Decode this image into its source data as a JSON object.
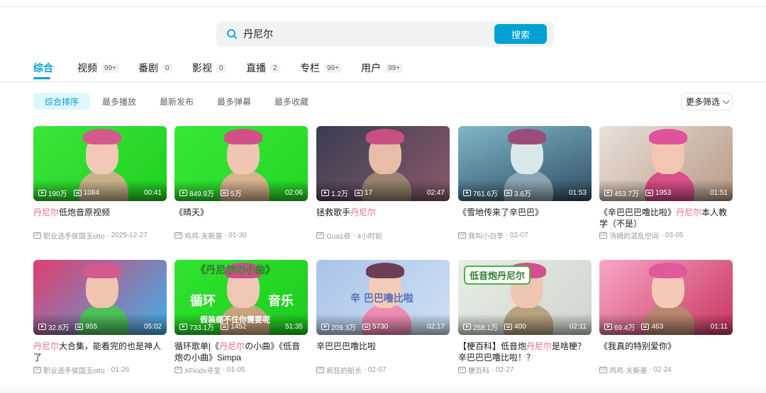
{
  "search": {
    "query": "丹尼尔",
    "button_label": "搜索"
  },
  "tabs": [
    {
      "label": "综合",
      "count": ""
    },
    {
      "label": "视频",
      "count": "99+"
    },
    {
      "label": "番剧",
      "count": "0"
    },
    {
      "label": "影视",
      "count": "0"
    },
    {
      "label": "直播",
      "count": "2"
    },
    {
      "label": "专栏",
      "count": "99+"
    },
    {
      "label": "用户",
      "count": "99+"
    }
  ],
  "sort": [
    "综合排序",
    "最多播放",
    "最新发布",
    "最多弹幕",
    "最多收藏"
  ],
  "more_filter": "更多筛选",
  "highlight_color": "#e86a9e",
  "accent_color": "#00a1d6",
  "videos": [
    {
      "views": "190万",
      "danmaku": "1084",
      "duration": "00:41",
      "title_parts": [
        [
          "丹尼尔",
          true
        ],
        [
          "低炮音原视频",
          false
        ]
      ],
      "author": "职业选手侯国玉otto",
      "date": "2025-12-27"
    },
    {
      "views": "849.9万",
      "danmaku": "5万",
      "duration": "02:06",
      "title_parts": [
        [
          "《晴天》",
          false
        ]
      ],
      "author": "鸡鸡·夫斯基",
      "date": "01-30"
    },
    {
      "views": "1.2万",
      "danmaku": "17",
      "duration": "02:47",
      "title_parts": [
        [
          "拯救歌手",
          false
        ],
        [
          "丹尼尔",
          true
        ]
      ],
      "author": "Gua1叔",
      "date": "4小时前"
    },
    {
      "views": "761.6万",
      "danmaku": "3.6万",
      "duration": "01:53",
      "title_parts": [
        [
          "《雪地传来了辛巴巴》",
          false
        ]
      ],
      "author": "我叫小白李",
      "date": "02-07"
    },
    {
      "views": "453.7万",
      "danmaku": "1953",
      "duration": "01:51",
      "title_parts": [
        [
          "《辛巴巴巴噜比啦》",
          false
        ],
        [
          "丹尼尔",
          true
        ],
        [
          "本人教学（不是）",
          false
        ]
      ],
      "author": "汤姆的混乱空间",
      "date": "03-05"
    },
    {
      "views": "32.8万",
      "danmaku": "955",
      "duration": "05:02",
      "title_parts": [
        [
          "丹尼尔",
          true
        ],
        [
          "大合集，能看完的也是神人了",
          false
        ]
      ],
      "author": "职业选手侯国玉otto",
      "date": "01-26"
    },
    {
      "views": "733.1万",
      "danmaku": "1452",
      "duration": "51:35",
      "title_parts": [
        [
          "循环歌单|《",
          false
        ],
        [
          "丹尼尔",
          true
        ],
        [
          "の小曲》《低音炮の小曲》Simpa",
          false
        ]
      ],
      "author": "XFinds寻宝",
      "date": "01-05"
    },
    {
      "views": "209.3万",
      "danmaku": "5730",
      "duration": "02:17",
      "title_parts": [
        [
          "辛巴巴巴噜比啦",
          false
        ]
      ],
      "author": "疯狂的船长",
      "date": "02-07"
    },
    {
      "views": "258.1万",
      "danmaku": "400",
      "duration": "02:11",
      "title_parts": [
        [
          "【梗百科】低音炮",
          false
        ],
        [
          "丹尼尔",
          true
        ],
        [
          "是啥梗？辛巴巴巴噜比啦！？",
          false
        ]
      ],
      "author": "梗百科",
      "date": "02-27"
    },
    {
      "views": "69.4万",
      "danmaku": "463",
      "duration": "01:11",
      "title_parts": [
        [
          "《我真的特别爱你》",
          false
        ]
      ],
      "author": "鸡鸡·夫斯基",
      "date": "02-24"
    }
  ],
  "thumb_overlays": {
    "v7_top": "《丹尼尔の小曲》",
    "v7_left": "循环",
    "v7_right": "音乐",
    "v7_bottom": "假装绷不住你需要呢",
    "v8_text": "辛 巴巴噜比啦",
    "v9_banner": "低音炮丹尼尔"
  }
}
